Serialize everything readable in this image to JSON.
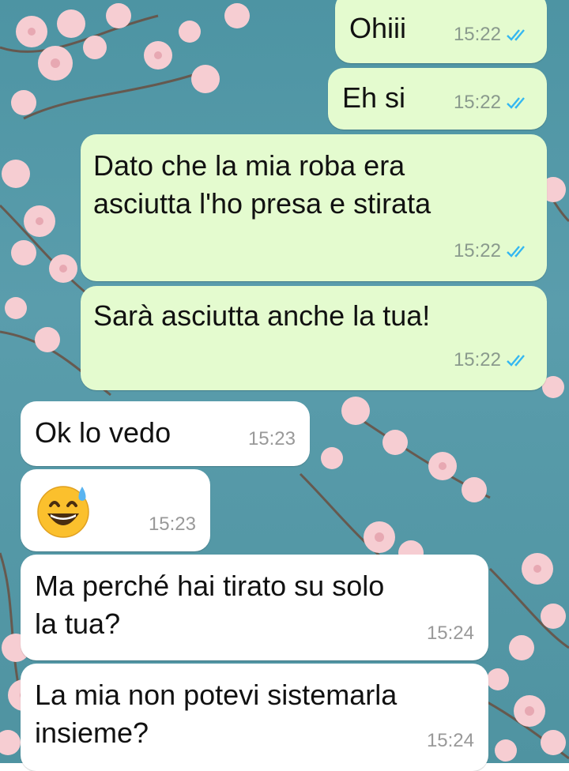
{
  "messages": [
    {
      "text": "Ohiii",
      "time": "15:22",
      "direction": "outgoing",
      "status": "read"
    },
    {
      "text": "Eh si",
      "time": "15:22",
      "direction": "outgoing",
      "status": "read"
    },
    {
      "text": "Dato che la mia roba era\nasciutta l'ho presa e stirata",
      "time": "15:22",
      "direction": "outgoing",
      "status": "read"
    },
    {
      "text": "Sarà asciutta anche la tua!",
      "time": "15:22",
      "direction": "outgoing",
      "status": "read"
    },
    {
      "text": "Ok lo vedo",
      "time": "15:23",
      "direction": "incoming"
    },
    {
      "emoji": "grinning-face-with-sweat",
      "time": "15:23",
      "direction": "incoming"
    },
    {
      "text": "Ma perché hai tirato su solo\nla tua?",
      "time": "15:24",
      "direction": "incoming"
    },
    {
      "text": "La mia non potevi sistemarla\ninsieme?",
      "time": "15:24",
      "direction": "incoming"
    }
  ],
  "colors": {
    "outgoing_bubble": "#e4fbcf",
    "incoming_bubble": "#ffffff",
    "read_ticks": "#34b7f1",
    "wallpaper_sky": "#4f93a1",
    "blossom": "#f6cdd2"
  }
}
